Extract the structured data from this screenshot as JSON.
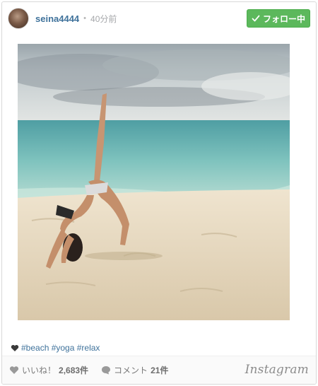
{
  "post": {
    "username": "seina4444",
    "separator": "•",
    "time_ago": "40分前",
    "follow_label": "フォロー中",
    "caption": "#beach #yoga #relax",
    "likes_label": "いいね！",
    "likes_count": "2,683件",
    "comments_label": "コメント",
    "comments_count": "21件",
    "brand": "Instagram"
  },
  "colors": {
    "follow_button": "#5cb85c",
    "link": "#3f729b"
  },
  "icons": [
    "check-icon",
    "heart-icon",
    "comment-icon"
  ]
}
